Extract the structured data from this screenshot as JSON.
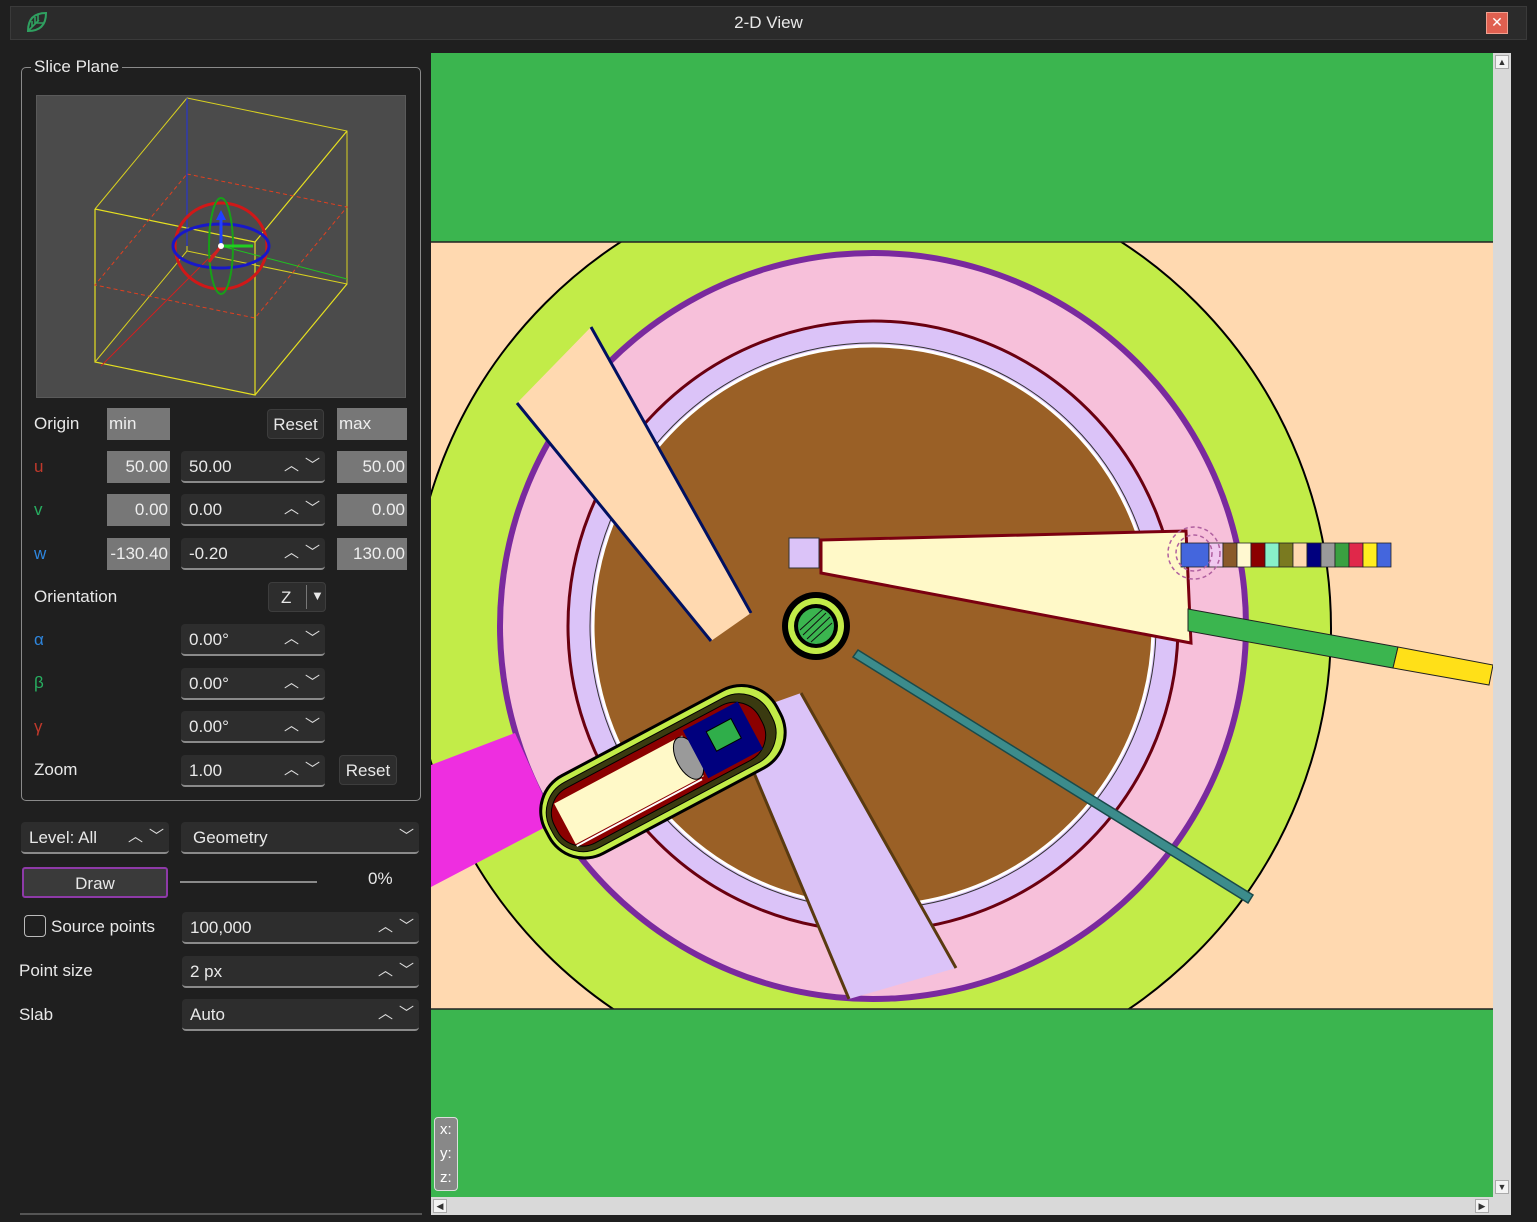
{
  "window": {
    "title": "2-D View",
    "close_icon": "close-icon",
    "logo_icon": "leaf-logo-icon"
  },
  "slice_plane": {
    "legend": "Slice Plane",
    "origin_label": "Origin",
    "min_label": "min",
    "max_label": "max",
    "reset_label": "Reset",
    "rows": [
      {
        "axis": "u",
        "min": "50.00",
        "value": "50.00",
        "max": "50.00"
      },
      {
        "axis": "v",
        "min": "0.00",
        "value": "0.00",
        "max": "0.00"
      },
      {
        "axis": "w",
        "min": "-130.40",
        "value": "-0.20",
        "max": "130.00"
      }
    ],
    "orientation_label": "Orientation",
    "orientation_value": "Z",
    "angles": [
      {
        "symbol": "α",
        "value": "0.00°"
      },
      {
        "symbol": "β",
        "value": "0.00°"
      },
      {
        "symbol": "γ",
        "value": "0.00°"
      }
    ],
    "zoom_label": "Zoom",
    "zoom_value": "1.00",
    "zoom_reset": "Reset"
  },
  "controls": {
    "level": "Level: All",
    "mode": "Geometry",
    "draw": "Draw",
    "progress": "0%",
    "source_points_label": "Source points",
    "source_points_checked": false,
    "source_points_value": "100,000",
    "point_size_label": "Point size",
    "point_size_value": "2 px",
    "slab_label": "Slab",
    "slab_value": "Auto"
  },
  "view": {
    "coords": [
      "x:",
      "y:",
      "z:"
    ],
    "colors": {
      "outer_green": "#3bb54f",
      "lime": "#c2ec48",
      "peach": "#ffd9b0",
      "pink": "#f7c0da",
      "lavender": "#dbc3f8",
      "brown": "#9a6026",
      "cream": "#fff9c8",
      "magenta": "#ee2ee0",
      "navy": "#00007e",
      "teal": "#3c8c8c",
      "yellow": "#ffe018",
      "purple_rim": "#7a2a9e"
    },
    "color_strip": [
      "#4466dd",
      "#f0c8f0",
      "#8a5a2a",
      "#fff8d0",
      "#8b0000",
      "#88f0c8",
      "#7a7a20",
      "#ffd9b0",
      "#00007e",
      "#9a9a9a",
      "#3aa040",
      "#e0284a",
      "#ffee20",
      "#4466dd"
    ]
  }
}
